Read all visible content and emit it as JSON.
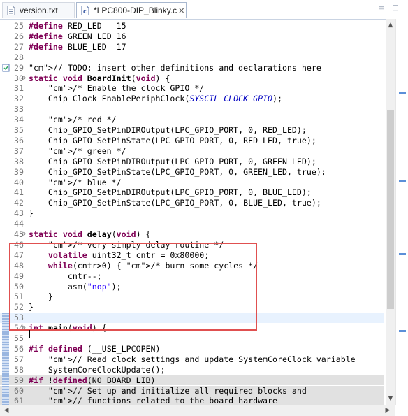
{
  "tabs": [
    {
      "label": "version.txt",
      "icon": "text-file-icon"
    },
    {
      "label": "*LPC800-DIP_Blinky.c",
      "icon": "c-file-icon",
      "close": "✕"
    }
  ],
  "window_buttons": {
    "minimize": "▭",
    "maximize": "□"
  },
  "scroll_glyphs": {
    "up": "▲",
    "down": "▼",
    "left": "◀",
    "right": "▶"
  },
  "colors": {
    "keyword": "#7f0055",
    "comment": "#3f7f5f",
    "string": "#2a00ff",
    "macro": "#0000c0",
    "highlight_box": "#e05050"
  },
  "lines": [
    {
      "n": "25",
      "code": "#define RED_LED   15"
    },
    {
      "n": "26",
      "code": "#define GREEN_LED 16"
    },
    {
      "n": "27",
      "code": "#define BLUE_LED  17"
    },
    {
      "n": "28",
      "code": ""
    },
    {
      "n": "29",
      "code": "// TODO: insert other definitions and declarations here"
    },
    {
      "n": "30",
      "code": "static void BoardInit(void) {"
    },
    {
      "n": "31",
      "code": "    /* Enable the clock GPIO */"
    },
    {
      "n": "32",
      "code": "    Chip_Clock_EnablePeriphClock(SYSCTL_CLOCK_GPIO);"
    },
    {
      "n": "33",
      "code": ""
    },
    {
      "n": "34",
      "code": "    /* red */"
    },
    {
      "n": "35",
      "code": "    Chip_GPIO_SetPinDIROutput(LPC_GPIO_PORT, 0, RED_LED);"
    },
    {
      "n": "36",
      "code": "    Chip_GPIO_SetPinState(LPC_GPIO_PORT, 0, RED_LED, true);"
    },
    {
      "n": "37",
      "code": "    /* green */"
    },
    {
      "n": "38",
      "code": "    Chip_GPIO_SetPinDIROutput(LPC_GPIO_PORT, 0, GREEN_LED);"
    },
    {
      "n": "39",
      "code": "    Chip_GPIO_SetPinState(LPC_GPIO_PORT, 0, GREEN_LED, true);"
    },
    {
      "n": "40",
      "code": "    /* blue */"
    },
    {
      "n": "41",
      "code": "    Chip_GPIO_SetPinDIROutput(LPC_GPIO_PORT, 0, BLUE_LED);"
    },
    {
      "n": "42",
      "code": "    Chip_GPIO_SetPinState(LPC_GPIO_PORT, 0, BLUE_LED, true);"
    },
    {
      "n": "43",
      "code": "}"
    },
    {
      "n": "44",
      "code": ""
    },
    {
      "n": "45",
      "code": "static void delay(void) {"
    },
    {
      "n": "46",
      "code": "    /* very simply delay routine */"
    },
    {
      "n": "47",
      "code": "    volatile uint32_t cntr = 0x80000;"
    },
    {
      "n": "48",
      "code": "    while(cntr>0) { /* burn some cycles */"
    },
    {
      "n": "49",
      "code": "        cntr--;"
    },
    {
      "n": "50",
      "code": "        asm(\"nop\");"
    },
    {
      "n": "51",
      "code": "    }"
    },
    {
      "n": "52",
      "code": "}"
    },
    {
      "n": "53",
      "code": ""
    },
    {
      "n": "54",
      "code": "int main(void) {"
    },
    {
      "n": "55",
      "code": ""
    },
    {
      "n": "56",
      "code": "#if defined (__USE_LPCOPEN)"
    },
    {
      "n": "57",
      "code": "    // Read clock settings and update SystemCoreClock variable"
    },
    {
      "n": "58",
      "code": "    SystemCoreClockUpdate();"
    },
    {
      "n": "59",
      "code": "#if !defined(NO_BOARD_LIB)"
    },
    {
      "n": "60",
      "code": "    // Set up and initialize all required blocks and"
    },
    {
      "n": "61",
      "code": "    // functions related to the board hardware"
    }
  ]
}
